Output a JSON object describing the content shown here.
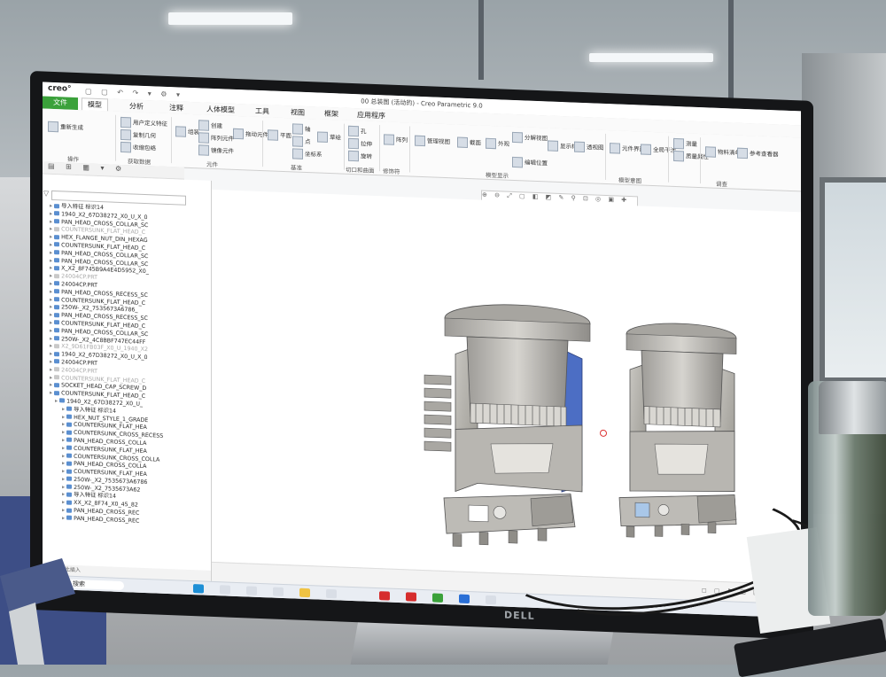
{
  "window": {
    "app_logo": "creo°",
    "title": "00 总装图 (活动的) - Creo Parametric 9.0",
    "quick_access": "▢ ▢ ↶ ↷ ▾ ⚙ ▾"
  },
  "menu": {
    "file": "文件",
    "items": [
      "模型",
      "分析",
      "注释",
      "人体模型",
      "工具",
      "视图",
      "框架",
      "应用程序"
    ],
    "active_index": 0
  },
  "ribbon": {
    "buttons": [
      {
        "label": "重新生成"
      },
      {
        "label": "用户定义特征"
      },
      {
        "label": "复制几何"
      },
      {
        "label": "收缩包络"
      },
      {
        "label": "组装"
      },
      {
        "label": "创建"
      },
      {
        "label": "拖动元件"
      },
      {
        "label": "阵列元件"
      },
      {
        "label": "镜像元件"
      },
      {
        "label": "平面"
      },
      {
        "label": "轴"
      },
      {
        "label": "点"
      },
      {
        "label": "坐标系"
      },
      {
        "label": "草绘"
      },
      {
        "label": "孔"
      },
      {
        "label": "拉伸"
      },
      {
        "label": "旋转"
      },
      {
        "label": "阵列"
      },
      {
        "label": "管理视图"
      },
      {
        "label": "截面"
      },
      {
        "label": "外观"
      },
      {
        "label": "分解视图"
      },
      {
        "label": "编辑位置"
      },
      {
        "label": "显示样式"
      },
      {
        "label": "透视图"
      },
      {
        "label": "元件界面"
      },
      {
        "label": "全局干涉"
      },
      {
        "label": "测量"
      },
      {
        "label": "质量属性"
      },
      {
        "label": "物料清单"
      },
      {
        "label": "参考查看器"
      }
    ],
    "groups": [
      "操作",
      "获取数据",
      "元件",
      "基准",
      "切口和曲面",
      "修饰符",
      "模型显示",
      "模型意图",
      "调查"
    ]
  },
  "model_tree": {
    "items": [
      {
        "text": "导入特征 标识14",
        "dim": false
      },
      {
        "text": "1940_X2_67D38272_X0_U_X_0",
        "dim": false
      },
      {
        "text": "PAN_HEAD_CROSS_COLLAR_SC",
        "dim": false
      },
      {
        "text": "COUNTERSUNK_FLAT_HEAD_C",
        "dim": true
      },
      {
        "text": "HEX_FLANGE_NUT_DIN_HEXAG",
        "dim": false
      },
      {
        "text": "COUNTERSUNK_FLAT_HEAD_C",
        "dim": false
      },
      {
        "text": "PAN_HEAD_CROSS_COLLAR_SC",
        "dim": false
      },
      {
        "text": "PAN_HEAD_CROSS_COLLAR_SC",
        "dim": false
      },
      {
        "text": "X_X2_8F745B9A4E4D5952_X0_",
        "dim": false
      },
      {
        "text": "24004CP.PRT",
        "dim": true
      },
      {
        "text": "24004CP.PRT",
        "dim": false
      },
      {
        "text": "PAN_HEAD_CROSS_RECESS_SC",
        "dim": false
      },
      {
        "text": "COUNTERSUNK_FLAT_HEAD_C",
        "dim": false
      },
      {
        "text": "250W-_X2_7535673A6786_",
        "dim": false
      },
      {
        "text": "PAN_HEAD_CROSS_RECESS_SC",
        "dim": false
      },
      {
        "text": "COUNTERSUNK_FLAT_HEAD_C",
        "dim": false
      },
      {
        "text": "PAN_HEAD_CROSS_COLLAR_SC",
        "dim": false
      },
      {
        "text": "250W-_X2_4C8BBF747EC44FF",
        "dim": false
      },
      {
        "text": "X2_9D61FB03F_X0_U_1940_X2",
        "dim": true
      },
      {
        "text": "1940_X2_67D38272_X0_U_X_0",
        "dim": false
      },
      {
        "text": "24004CP.PRT",
        "dim": false
      },
      {
        "text": "24004CP.PRT",
        "dim": true
      },
      {
        "text": "COUNTERSUNK_FLAT_HEAD_C",
        "dim": true
      },
      {
        "text": "SOCKET_HEAD_CAP_SCREW_D",
        "dim": false
      },
      {
        "text": "COUNTERSUNK_FLAT_HEAD_C",
        "dim": false
      },
      {
        "text": "1940_X2_67D38272_X0_U_",
        "dim": false
      },
      {
        "text": "导入特征 标识14",
        "dim": false
      },
      {
        "text": "HEX_NUT_STYLE_1_GRADE",
        "dim": false
      },
      {
        "text": "COUNTERSUNK_FLAT_HEA",
        "dim": false
      },
      {
        "text": "COUNTERSUNK_CROSS_RECESS",
        "dim": false
      },
      {
        "text": "PAN_HEAD_CROSS_COLLA",
        "dim": false
      },
      {
        "text": "COUNTERSUNK_FLAT_HEA",
        "dim": false
      },
      {
        "text": "COUNTERSUNK_CROSS_COLLA",
        "dim": false
      },
      {
        "text": "PAN_HEAD_CROSS_COLLA",
        "dim": false
      },
      {
        "text": "COUNTERSUNK_FLAT_HEA",
        "dim": false
      },
      {
        "text": "250W-_X2_7535673A6786",
        "dim": false
      },
      {
        "text": "250W-_X2_7535673A62",
        "dim": false
      },
      {
        "text": "导入特征 标识14",
        "dim": false
      },
      {
        "text": "XX_X2_8F74_X0_45_82",
        "dim": false
      },
      {
        "text": "PAN_HEAD_CROSS_REC",
        "dim": false
      },
      {
        "text": "PAN_HEAD_CROSS_REC",
        "dim": false
      }
    ],
    "footer": "▸ 在此插入"
  },
  "taskbar": {
    "search_text": "搜索",
    "apps": [
      "M5",
      "11K",
      "",
      "CLR",
      "E",
      "202",
      "",
      "A",
      "A",
      "W",
      "",
      "",
      "",
      "",
      "",
      ""
    ]
  },
  "monitor_brand": "DELL",
  "colors": {
    "creo_green": "#3aa13a",
    "part_blue": "#5b8fd0",
    "model_grey": "#b9b7b2",
    "model_blue_face": "#4c6ec4"
  }
}
